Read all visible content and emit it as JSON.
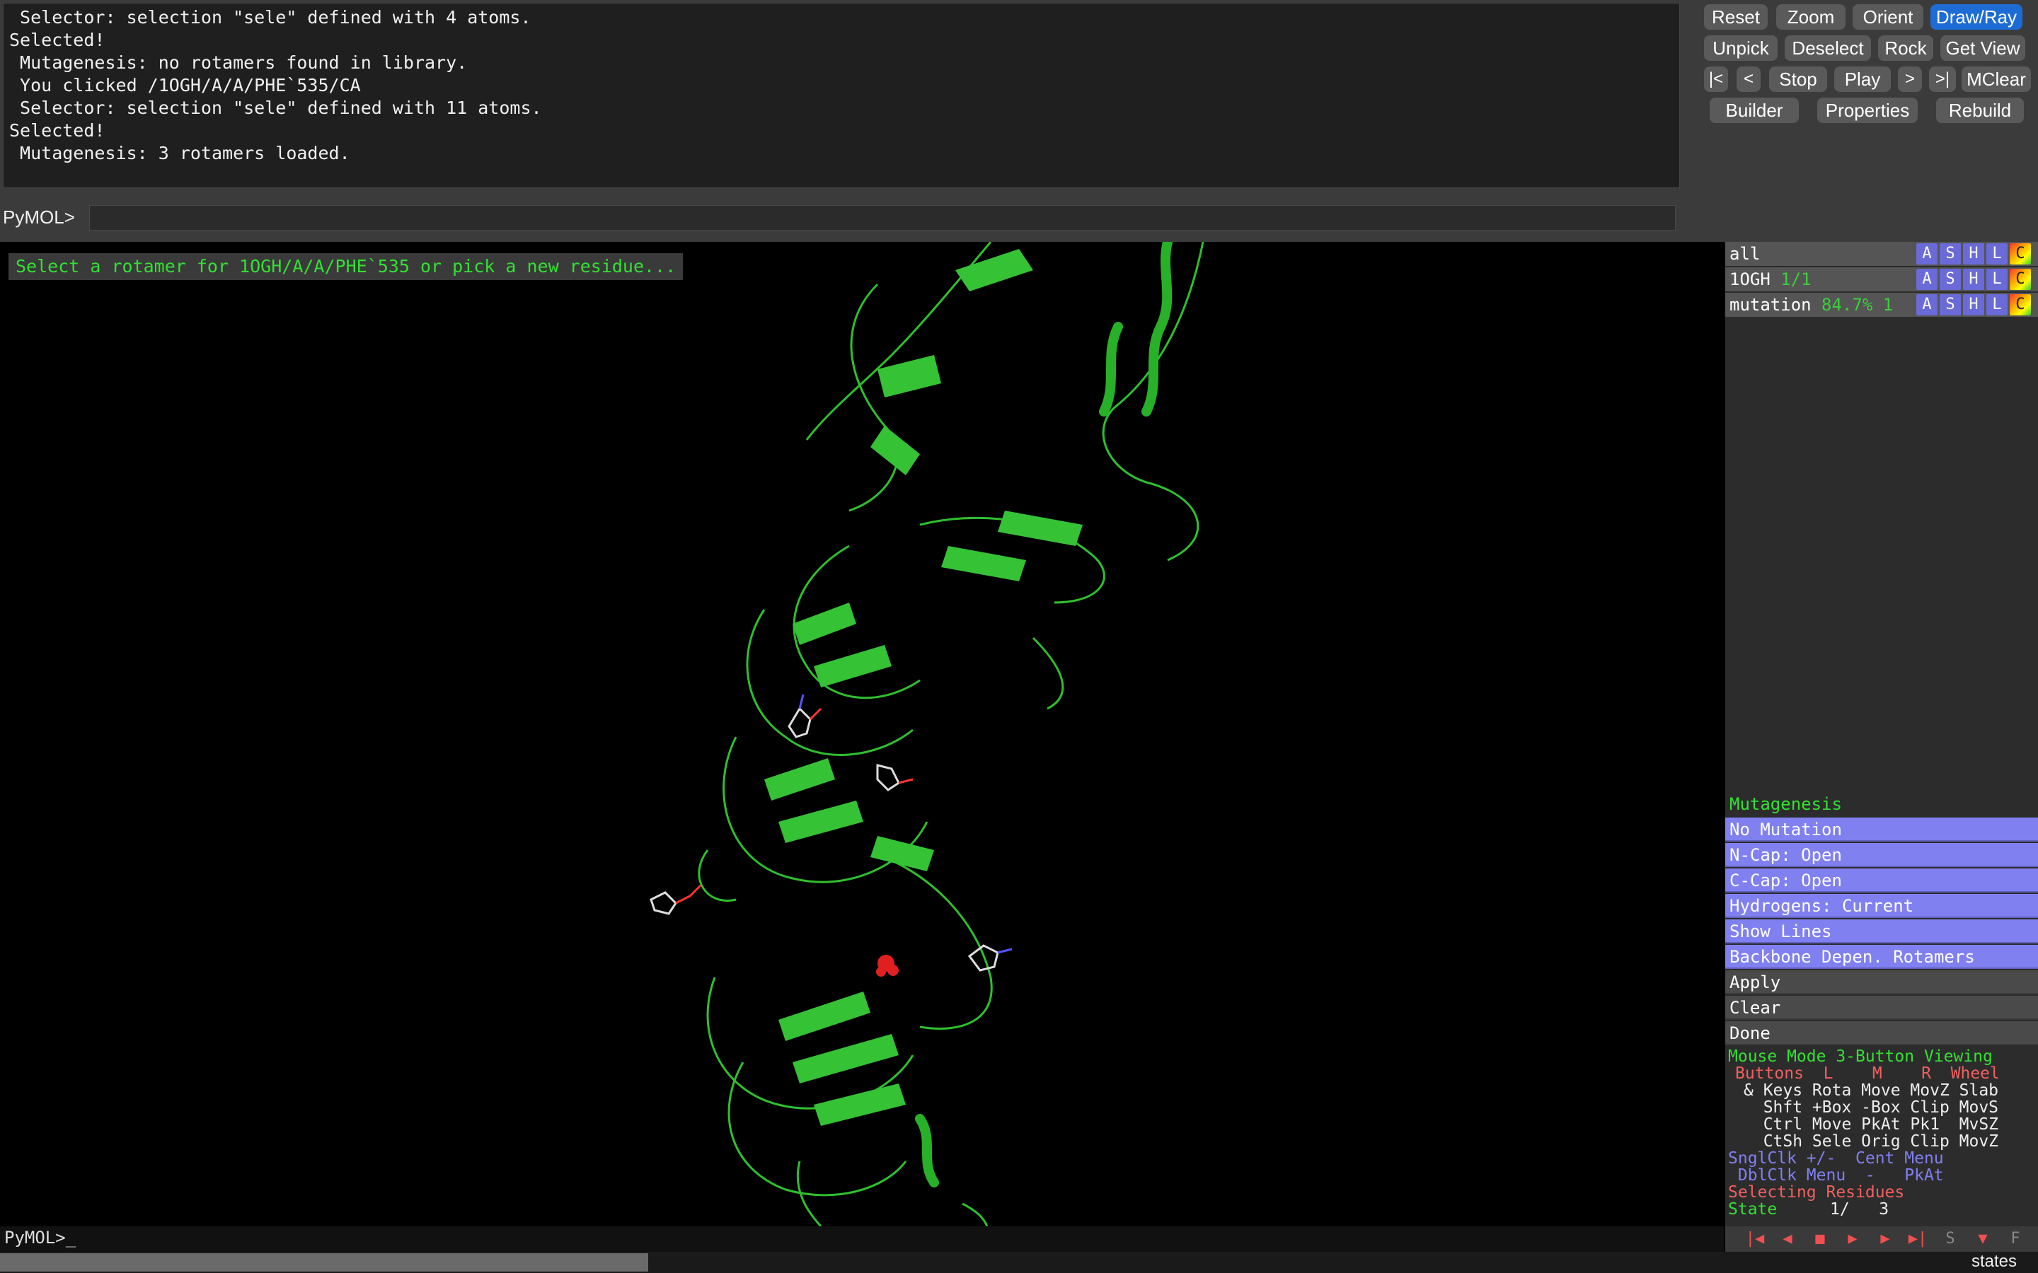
{
  "log": {
    "lines": [
      " Selector: selection \"sele\" defined with 4 atoms.",
      "Selected!",
      " Mutagenesis: no rotamers found in library.",
      " You clicked /1OGH/A/A/PHE`535/CA",
      " Selector: selection \"sele\" defined with 11 atoms.",
      "Selected!",
      " Mutagenesis: 3 rotamers loaded."
    ]
  },
  "prompt": {
    "label": "PyMOL>",
    "value": ""
  },
  "buttons": {
    "row1": [
      "Reset",
      "Zoom",
      "Orient",
      "Draw/Ray"
    ],
    "row2": [
      "Unpick",
      "Deselect",
      "Rock",
      "Get View"
    ],
    "row3": [
      "|<",
      "<",
      "Stop",
      "Play",
      ">",
      ">|",
      "MClear"
    ],
    "row4": [
      "Builder",
      "Properties",
      "Rebuild"
    ]
  },
  "viewer": {
    "status_message": "Select a rotamer for 1OGH/A/A/PHE`535 or pick a new residue..."
  },
  "objects": [
    {
      "name": "all",
      "extra": ""
    },
    {
      "name": "1OGH",
      "extra": " 1/1"
    },
    {
      "name": "mutation",
      "extra": " 84.7% 1"
    }
  ],
  "object_buttons": [
    "A",
    "S",
    "H",
    "L",
    "C"
  ],
  "mutagenesis": {
    "header": "Mutagenesis",
    "options": [
      "No Mutation",
      "N-Cap: Open",
      "C-Cap: Open",
      "Hydrogens: Current",
      "Show Lines",
      "Backbone Depen. Rotamers"
    ],
    "actions": [
      "Apply",
      "Clear",
      "Done"
    ]
  },
  "mouse_help": {
    "title": "Mouse Mode 3-Button Viewing",
    "buttons_row": "Buttons  L    M    R  Wheel",
    "keys_row": "& Keys Rota Move MovZ Slab",
    "shft_row": "  Shft +Box -Box Clip MovS",
    "ctrl_row": "  Ctrl Move PkAt Pk1  MvSZ",
    "ctsh_row": "  CtSh Sele Orig Clip MovZ",
    "snglclk_row": "SnglClk +/-  Cent Menu",
    "dblclk_row": " DblClk Menu  -   PkAt",
    "selecting": "Selecting Residues",
    "state_label": "State",
    "state_value": "1/   3"
  },
  "bottom": {
    "prompt": "PyMOL>_",
    "states_label": "states"
  },
  "play_controls": [
    "|◀",
    "◀",
    "■",
    "▶",
    "▶",
    "▶|",
    "S",
    "▼",
    "F"
  ],
  "colors": {
    "cartoon": "#2fbf2f",
    "mutation": "#e02020",
    "accent": "#1d6cd6"
  }
}
